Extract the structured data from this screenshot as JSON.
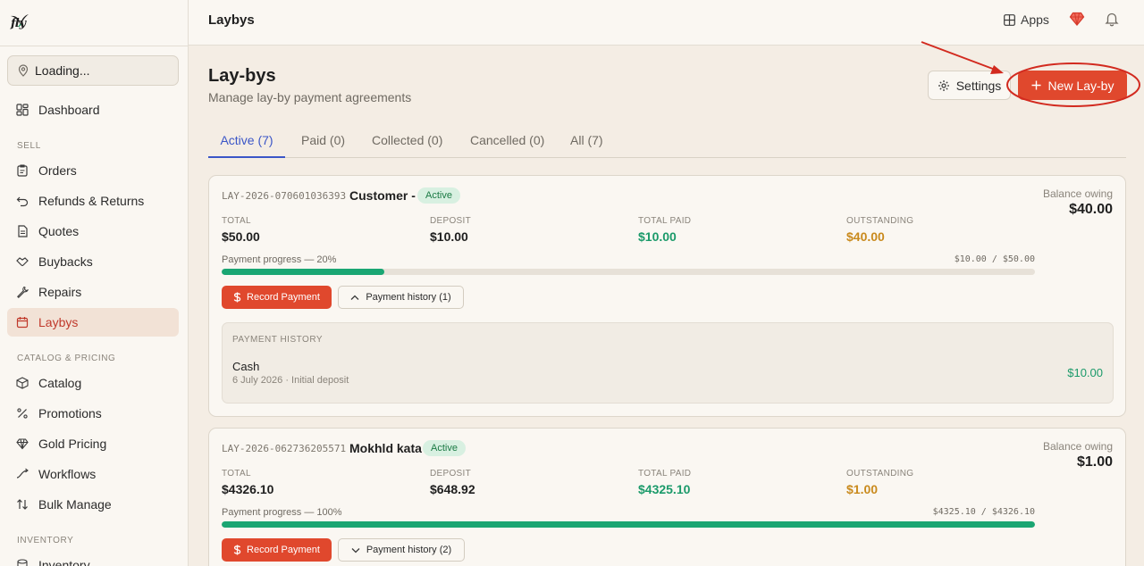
{
  "app": {
    "logo_text": "fly"
  },
  "sidebar": {
    "location": "Loading...",
    "items": [
      {
        "label": "Dashboard"
      },
      {
        "label": "Orders"
      },
      {
        "label": "Refunds & Returns"
      },
      {
        "label": "Quotes"
      },
      {
        "label": "Buybacks"
      },
      {
        "label": "Repairs"
      },
      {
        "label": "Laybys"
      },
      {
        "label": "Catalog"
      },
      {
        "label": "Promotions"
      },
      {
        "label": "Gold Pricing"
      },
      {
        "label": "Workflows"
      },
      {
        "label": "Bulk Manage"
      },
      {
        "label": "Inventory"
      }
    ],
    "sections": {
      "sell": "SELL",
      "catalog": "CATALOG & PRICING",
      "inventory": "INVENTORY"
    },
    "active_item": "Laybys"
  },
  "header": {
    "title": "Laybys",
    "apps_label": "Apps"
  },
  "page": {
    "title": "Lay-bys",
    "subtitle": "Manage lay-by payment agreements",
    "settings_label": "Settings",
    "new_label": "New Lay-by"
  },
  "tabs": [
    {
      "label": "Active (7)",
      "active": true
    },
    {
      "label": "Paid (0)"
    },
    {
      "label": "Collected (0)"
    },
    {
      "label": "Cancelled (0)"
    },
    {
      "label": "All (7)"
    }
  ],
  "laybys": [
    {
      "ref": "LAY-2026-070601036393",
      "customer": "Customer -",
      "status": "Active",
      "balance_label": "Balance owing",
      "balance": "$40.00",
      "stats": [
        {
          "label": "TOTAL",
          "value": "$50.00"
        },
        {
          "label": "DEPOSIT",
          "value": "$10.00"
        },
        {
          "label": "TOTAL PAID",
          "value": "$10.00"
        },
        {
          "label": "OUTSTANDING",
          "value": "$40.00"
        }
      ],
      "progress_label": "Payment progress — 20%",
      "progress_amount": "$10.00 / $50.00",
      "progress_fraction": 0.2,
      "record_label": "Record Payment",
      "history_label": "Payment history (1)",
      "history_expanded": true,
      "history": {
        "title": "PAYMENT HISTORY",
        "entries": [
          {
            "method": "Cash",
            "meta": "6 July 2026 · Initial deposit",
            "amount": "$10.00"
          }
        ]
      }
    },
    {
      "ref": "LAY-2026-062736205571",
      "customer": "Mokhld kata",
      "status": "Active",
      "balance_label": "Balance owing",
      "balance": "$1.00",
      "stats": [
        {
          "label": "TOTAL",
          "value": "$4326.10"
        },
        {
          "label": "DEPOSIT",
          "value": "$648.92"
        },
        {
          "label": "TOTAL PAID",
          "value": "$4325.10"
        },
        {
          "label": "OUTSTANDING",
          "value": "$1.00"
        }
      ],
      "progress_label": "Payment progress — 100%",
      "progress_amount": "$4325.10 / $4326.10",
      "progress_fraction": 0.9998,
      "record_label": "Record Payment",
      "history_label": "Payment history (2)",
      "history_expanded": false
    }
  ],
  "colors": {
    "accent": "#e0482d",
    "tab_active": "#3b56c7",
    "paid_green": "#1b9a6a",
    "outstanding_amber": "#c98a1d",
    "annotation_red": "#d22a1f"
  }
}
